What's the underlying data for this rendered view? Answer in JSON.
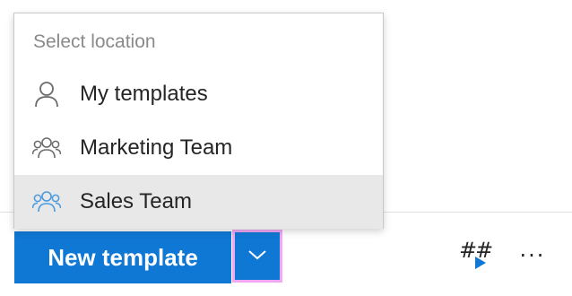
{
  "menu": {
    "header": "Select location",
    "items": [
      {
        "label": "My templates",
        "icon": "person-icon",
        "selected": false
      },
      {
        "label": "Marketing Team",
        "icon": "people-icon",
        "selected": false
      },
      {
        "label": "Sales Team",
        "icon": "people-icon",
        "selected": true
      }
    ]
  },
  "toolbar": {
    "new_template_label": "New template",
    "split_dropdown_icon": "chevron-down-icon",
    "hash_label": "##",
    "hash_icon": "play-icon",
    "more_label": "···"
  },
  "colors": {
    "primary": "#0f78d4",
    "focus_outline": "#f0a8f5",
    "selected_item_bg": "#e8e8e8",
    "people_icon_highlight": "#4a9be0"
  }
}
